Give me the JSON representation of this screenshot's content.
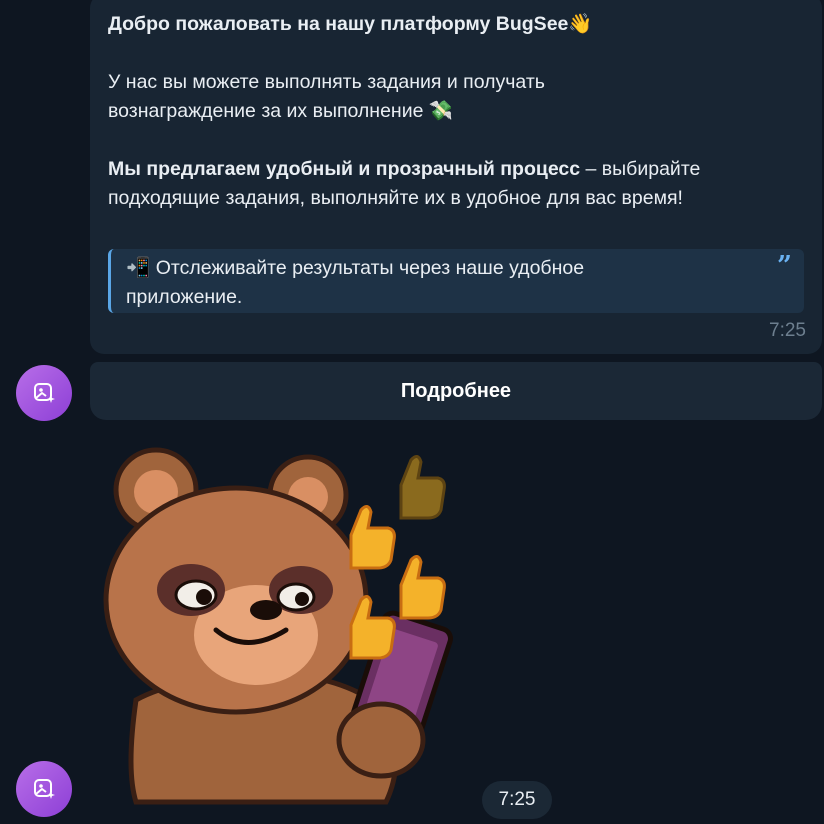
{
  "message": {
    "line1": "Добро пожаловать на нашу платформу BugSee",
    "line1_emoji": "👋",
    "line2": "У нас вы можете выполнять задания и получать",
    "line3": "вознаграждение за их выполнение",
    "line3_emoji": "💸",
    "line4_bold": "Мы предлагаем удобный и прозрачный процесс",
    "line4_rest": " – выбирайте",
    "line5": "подходящие задания, выполняйте их в удобное для вас время!",
    "quote_emoji": "📲",
    "quote_line1": "Отслеживайте результаты через наше удобное",
    "quote_line2": "приложение.",
    "time": "7:25"
  },
  "inline_button": {
    "label": "Подробнее"
  },
  "sticker": {
    "time": "7:25",
    "icon": "bear-thumbs-up-sticker"
  },
  "colors": {
    "background": "#0e1621",
    "bubble": "#182533",
    "quote_bar": "#5aa6e6",
    "avatar": "#9b4fe0"
  }
}
